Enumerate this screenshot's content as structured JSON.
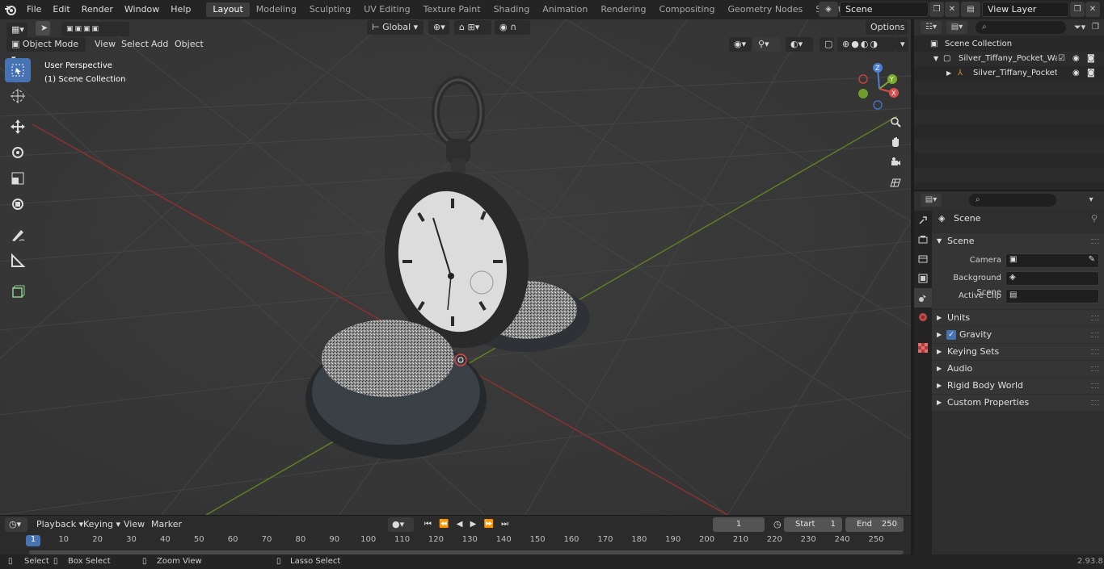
{
  "menu": [
    "File",
    "Edit",
    "Render",
    "Window",
    "Help"
  ],
  "workspaces": [
    "Layout",
    "Modeling",
    "Sculpting",
    "UV Editing",
    "Texture Paint",
    "Shading",
    "Animation",
    "Rendering",
    "Compositing",
    "Geometry Nodes",
    "Scripting"
  ],
  "active_workspace": "Layout",
  "scene_name": "Scene",
  "view_layer_name": "View Layer",
  "viewport": {
    "mode": "Object Mode",
    "menus": [
      "View",
      "Select",
      "Add",
      "Object"
    ],
    "orientation": "Global",
    "options_label": "Options",
    "perspective_label": "User Perspective",
    "collection_label": "(1) Scene Collection"
  },
  "timeline": {
    "menus": [
      "Playback",
      "Keying",
      "View",
      "Marker"
    ],
    "current_frame": "1",
    "start_label": "Start",
    "start_value": "1",
    "end_label": "End",
    "end_value": "250",
    "ruler_marks": [
      "1",
      "10",
      "20",
      "30",
      "40",
      "50",
      "60",
      "70",
      "80",
      "90",
      "100",
      "110",
      "120",
      "130",
      "140",
      "150",
      "160",
      "170",
      "180",
      "190",
      "200",
      "210",
      "220",
      "230",
      "240",
      "250"
    ]
  },
  "status": {
    "select": "Select",
    "box_select": "Box Select",
    "zoom_view": "Zoom View",
    "lasso_select": "Lasso Select",
    "version": "2.93.8"
  },
  "outliner": {
    "root": "Scene Collection",
    "collection": "Silver_Tiffany_Pocket_Watch_",
    "object": "Silver_Tiffany_Pocket_Wa"
  },
  "properties": {
    "context": "Scene",
    "panel_scene": "Scene",
    "camera_label": "Camera",
    "background_scene_label": "Background Scene",
    "active_clip_label": "Active Clip",
    "panels": [
      "Units",
      "Gravity",
      "Keying Sets",
      "Audio",
      "Rigid Body World",
      "Custom Properties"
    ],
    "gravity_enabled": true
  },
  "colors": {
    "accent": "#4772b3",
    "axis_x": "#a03a3a",
    "axis_y": "#6a8a2a",
    "viewport_bg": "#393939"
  }
}
